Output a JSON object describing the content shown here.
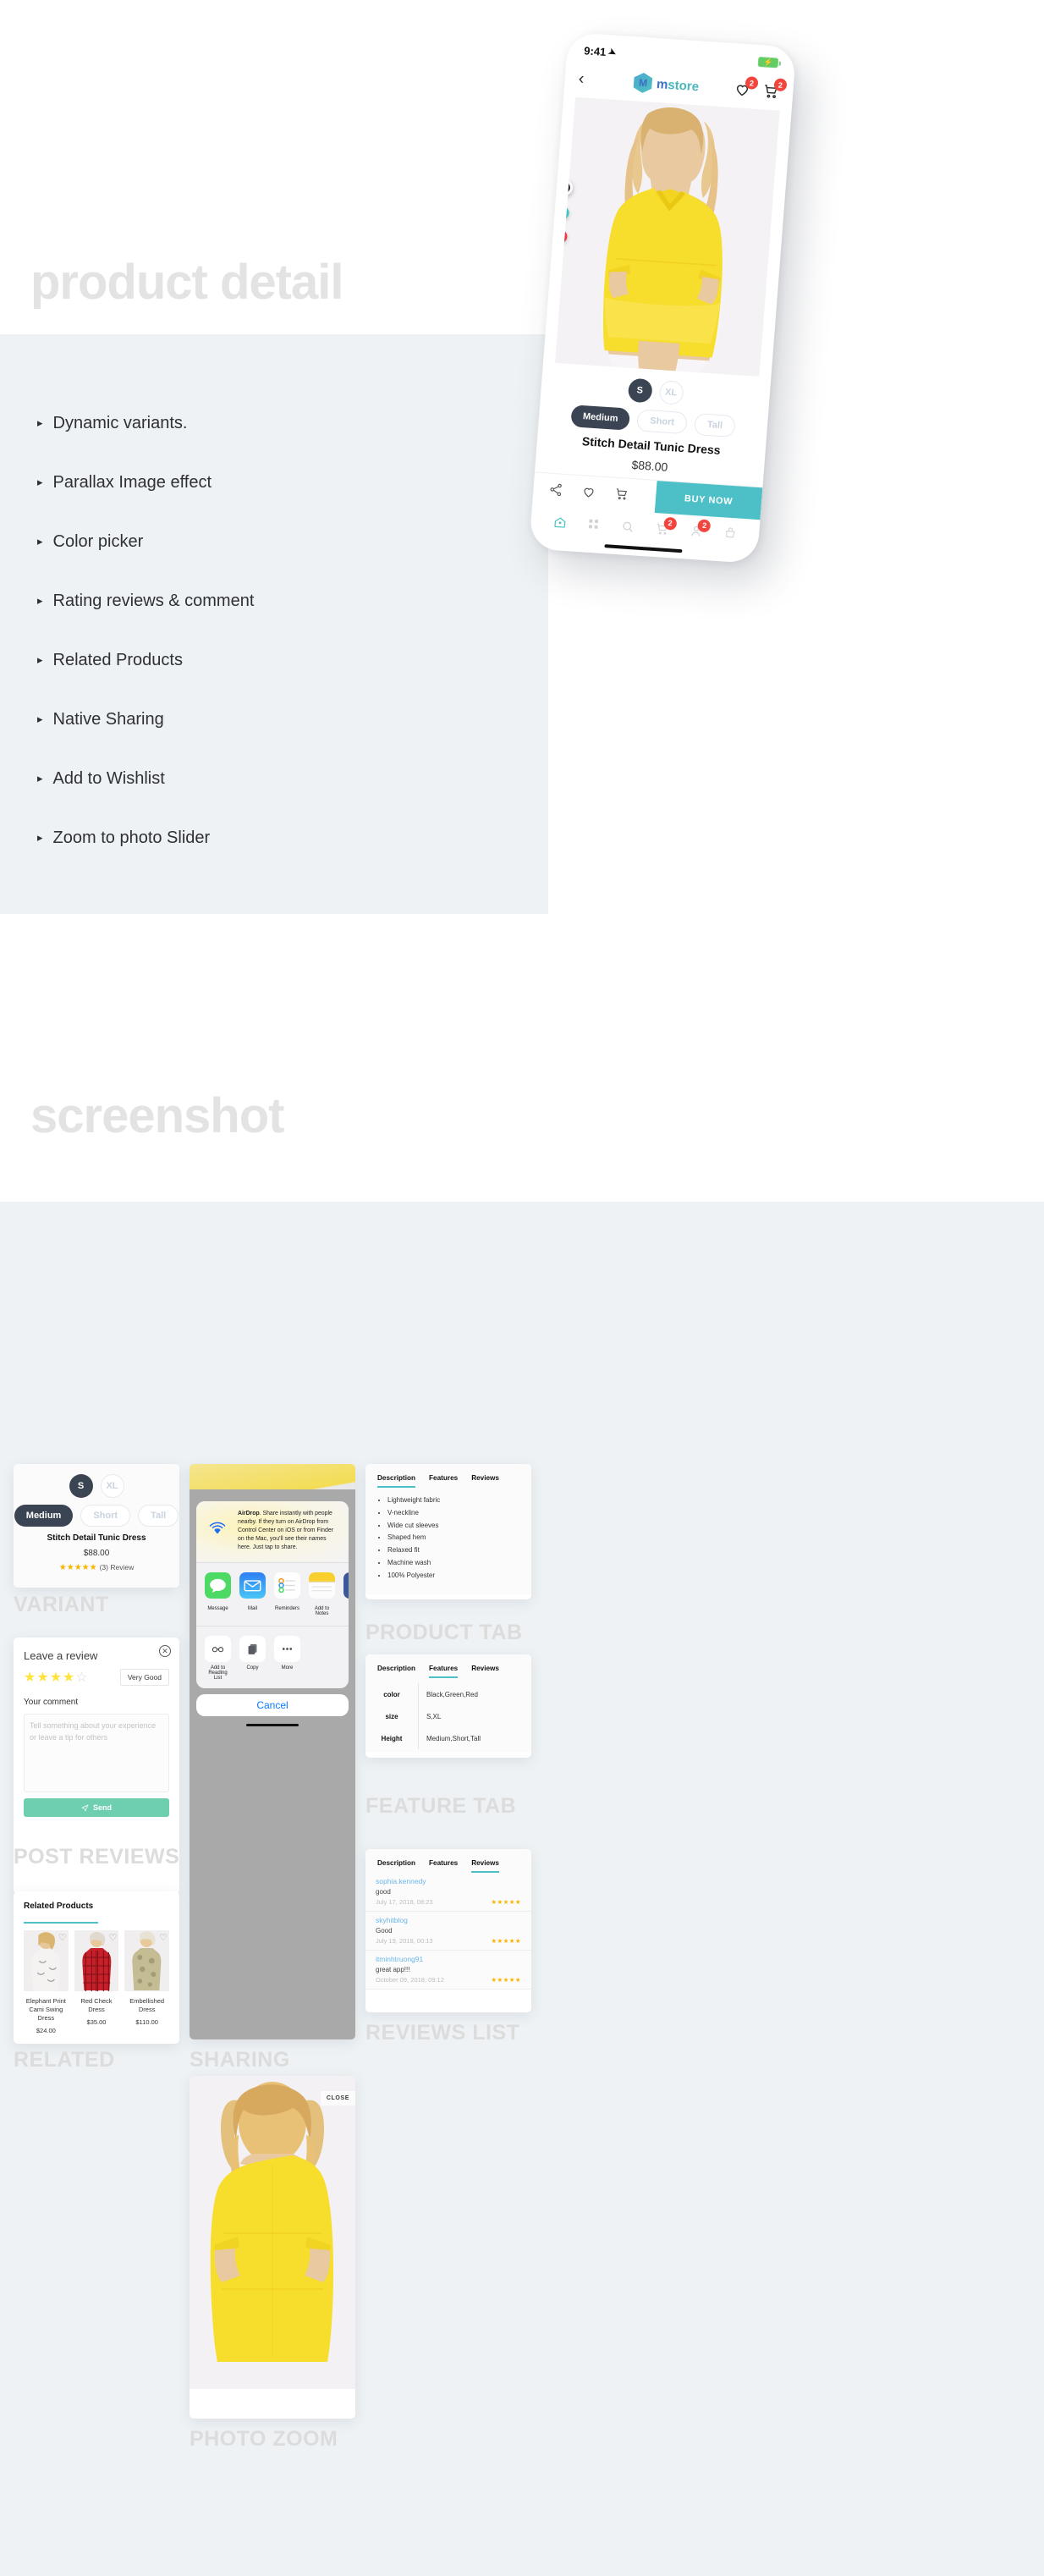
{
  "top": {
    "ghost_title_1": "product detail",
    "ghost_title_2": "screenshot",
    "features": [
      "Dynamic variants.",
      "Parallax Image effect",
      "Color picker",
      "Rating reviews & comment",
      "Related Products",
      "Native Sharing",
      "Add to Wishlist",
      "Zoom to photo Slider"
    ]
  },
  "phone": {
    "status": {
      "time": "9:41",
      "location_icon": "location-arrow-icon",
      "battery_icon": "battery-charging-icon"
    },
    "appbar": {
      "back_icon": "back-chevron-icon",
      "brand_m": "M",
      "brand_part1": "m",
      "brand_part2": "store",
      "wishlist_icon": "heart-icon",
      "wishlist_badge": "2",
      "cart_icon": "cart-icon",
      "cart_badge": "2"
    },
    "colors": [
      "#1c1c1c",
      "#3fc3c3",
      "#ec3b43"
    ],
    "sizes": [
      {
        "label": "S",
        "selected": true
      },
      {
        "label": "XL",
        "selected": false
      }
    ],
    "heights": [
      {
        "label": "Medium",
        "selected": true
      },
      {
        "label": "Short",
        "selected": false
      },
      {
        "label": "Tall",
        "selected": false
      }
    ],
    "product_title": "Stitch Detail Tunic Dress",
    "price": "$88.00",
    "actions": {
      "share_icon": "share-icon",
      "wishlist_icon": "heart-icon",
      "cart_icon": "cart-icon",
      "buy_label": "BUY NOW"
    },
    "tabbar": [
      {
        "icon": "home-icon",
        "active": true
      },
      {
        "icon": "grid-icon",
        "active": false
      },
      {
        "icon": "search-icon",
        "active": false
      },
      {
        "icon": "cart-icon",
        "active": false,
        "badge": "2"
      },
      {
        "icon": "user-icon",
        "active": false,
        "badge": "2"
      },
      {
        "icon": "basket-icon",
        "active": false
      }
    ]
  },
  "cards": {
    "variant": {
      "label": "VARIANT",
      "sizes": [
        {
          "label": "S",
          "selected": true
        },
        {
          "label": "XL",
          "selected": false
        }
      ],
      "heights": [
        {
          "label": "Medium",
          "selected": true
        },
        {
          "label": "Short",
          "selected": false
        },
        {
          "label": "Tall",
          "selected": false
        }
      ],
      "title": "Stitch Detail Tunic Dress",
      "price": "$88.00",
      "stars": "★★★★★",
      "review_count": "(3) Review"
    },
    "post_reviews": {
      "label": "POST REVIEWS",
      "heading": "Leave a review",
      "stars_on": "★★★★",
      "stars_off": "☆",
      "rating_text": "Very Good",
      "comment_label": "Your comment",
      "comment_placeholder": "Tell something about your experience or leave a tip for others",
      "send_label": "Send",
      "close_icon": "close-circle-icon",
      "send_icon": "send-paper-plane-icon"
    },
    "related": {
      "label": "RELATED",
      "heading": "Related Products",
      "products": [
        {
          "name": "Elephant Print Cami Swing Dress",
          "price": "$24.00"
        },
        {
          "name": "Red Check Dress",
          "price": "$35.00"
        },
        {
          "name": "Embellished Dress",
          "price": "$110.00"
        }
      ]
    },
    "sharing": {
      "label": "SHARING",
      "airdrop_title": "AirDrop",
      "airdrop_text": ". Share instantly with people nearby. If they turn on AirDrop from Control Center on iOS or from Finder on the Mac, you’ll see their names here. Just tap to share.",
      "apps": [
        "Message",
        "Mail",
        "Reminders",
        "Add to Notes"
      ],
      "actions": [
        "Add to Reading List",
        "Copy",
        "More"
      ],
      "cancel_label": "Cancel"
    },
    "photo_zoom": {
      "label": "PHOTO ZOOM",
      "close_label": "CLOSE"
    },
    "product_tab": {
      "label": "PRODUCT TAB",
      "tabs": [
        "Description",
        "Features",
        "Reviews"
      ],
      "active_tab": "Description",
      "bullets": [
        "Lightweight fabric",
        "V-neckline",
        "Wide cut sleeves",
        "Shaped hem",
        "Relaxed fit",
        "Machine wash",
        "100% Polyester"
      ]
    },
    "feature_tab": {
      "label": "FEATURE TAB",
      "tabs": [
        "Description",
        "Features",
        "Reviews"
      ],
      "active_tab": "Features",
      "rows": [
        {
          "key": "color",
          "value": "Black,Green,Red"
        },
        {
          "key": "size",
          "value": "S,XL"
        },
        {
          "key": "Height",
          "value": "Medium,Short,Tall"
        }
      ]
    },
    "reviews_list": {
      "label": "REVIEWS LIST",
      "tabs": [
        "Description",
        "Features",
        "Reviews"
      ],
      "active_tab": "Reviews",
      "reviews": [
        {
          "user": "sophia.kennedy",
          "text": "good",
          "date": "July 17, 2018, 08:23",
          "stars": "★★★★★"
        },
        {
          "user": "skyhitblog",
          "text": "Good",
          "date": "July 19, 2018, 00:13",
          "stars": "★★★★★"
        },
        {
          "user": "itminhtruong91",
          "text": "great app!!!",
          "date": "October 09, 2018, 09:12",
          "stars": "★★★★★"
        }
      ]
    }
  },
  "theme": {
    "accent": "#4cc0c6",
    "panel_bg": "#eef2f4",
    "dark_chip": "#3b4452",
    "badge_red": "#f2453d",
    "send_green": "#6ecfb0",
    "star_yellow": "#f7b500"
  }
}
